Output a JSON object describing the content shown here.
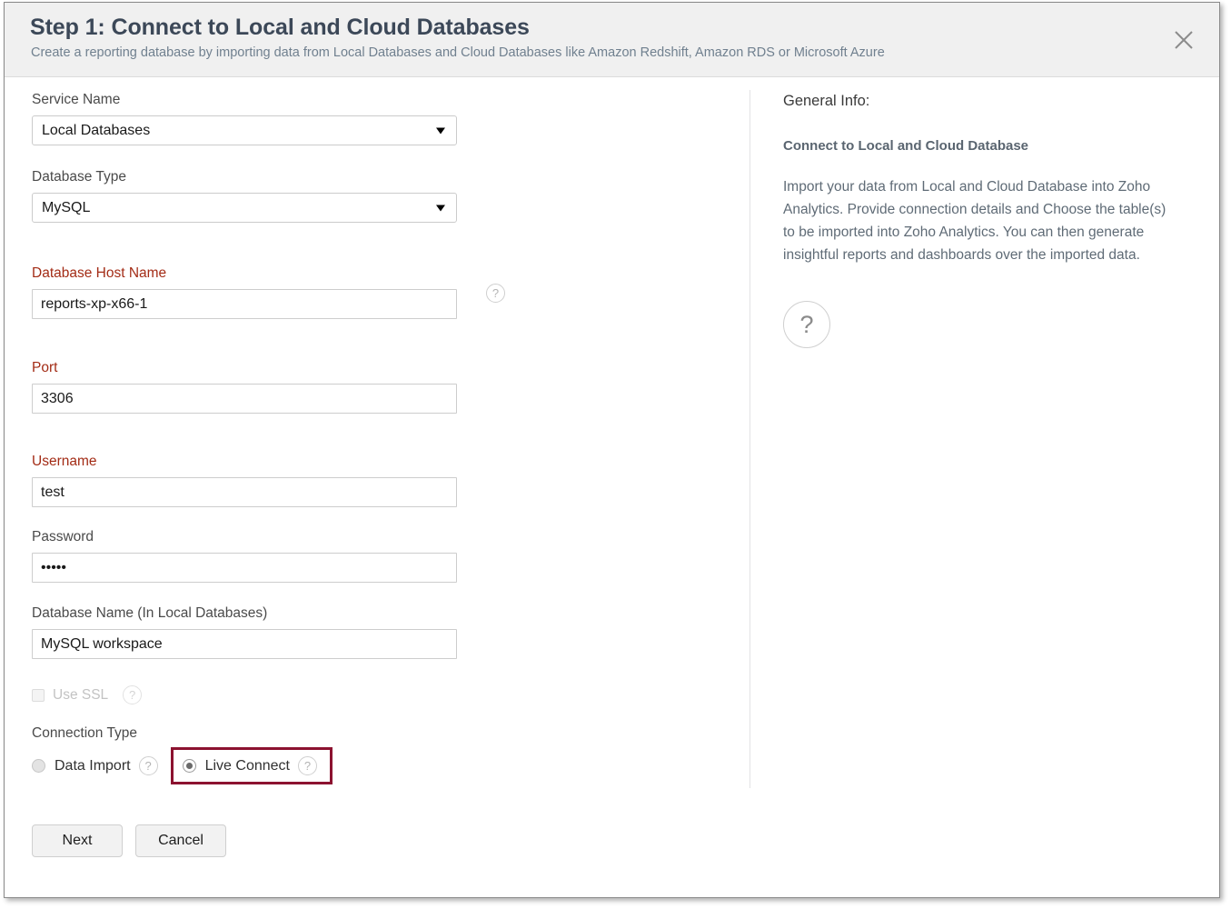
{
  "header": {
    "title": "Step 1: Connect to Local and Cloud Databases",
    "subtitle": "Create a reporting database by importing data from Local Databases and Cloud Databases like Amazon Redshift, Amazon RDS or Microsoft Azure",
    "close_icon": "close-icon"
  },
  "form": {
    "service_name": {
      "label": "Service Name",
      "value": "Local Databases"
    },
    "database_type": {
      "label": "Database Type",
      "value": "MySQL"
    },
    "database_host_name": {
      "label": "Database Host Name",
      "value": "reports-xp-x66-1",
      "help": "?"
    },
    "port": {
      "label": "Port",
      "value": "3306"
    },
    "username": {
      "label": "Username",
      "value": "test"
    },
    "password": {
      "label": "Password",
      "value": "•••••"
    },
    "database_name": {
      "label": "Database Name (In Local Databases)",
      "value": "MySQL workspace"
    },
    "use_ssl": {
      "label": "Use SSL",
      "help": "?"
    },
    "connection_type": {
      "label": "Connection Type",
      "options": [
        {
          "label": "Data Import",
          "help": "?",
          "selected": false
        },
        {
          "label": "Live Connect",
          "help": "?",
          "selected": true
        }
      ]
    }
  },
  "buttons": {
    "next": "Next",
    "cancel": "Cancel"
  },
  "info": {
    "title": "General Info:",
    "subtitle": "Connect to Local and Cloud Database",
    "body": "Import your data from Local and Cloud Database into Zoho Analytics. Provide connection details and Choose the table(s) to be imported into Zoho Analytics. You can then generate insightful reports and dashboards over the imported data.",
    "help": "?"
  },
  "colors": {
    "required_label": "#a32c16",
    "highlight_border": "#8c1230",
    "header_bg": "#f0f0f0"
  }
}
